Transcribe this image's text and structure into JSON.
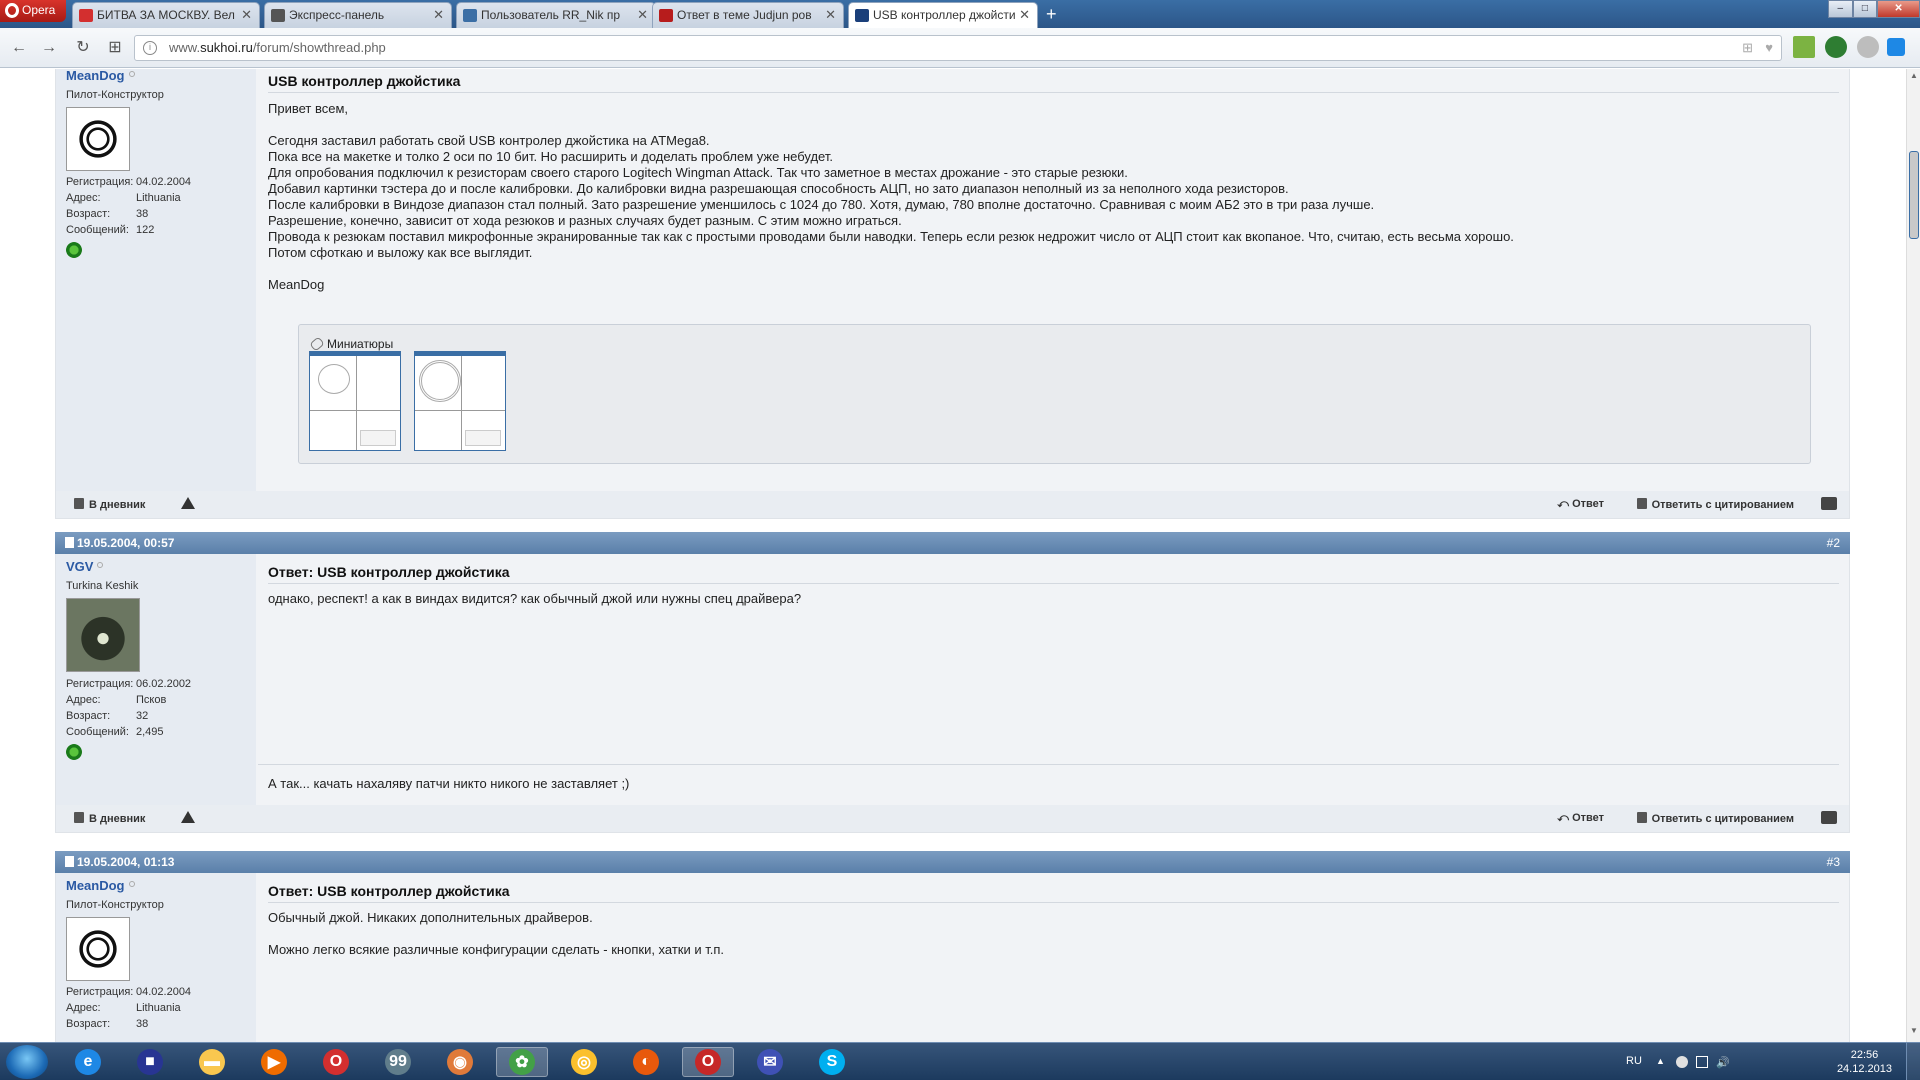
{
  "browser": {
    "menu_label": "Opera",
    "tabs": [
      {
        "title": "БИТВА ЗА МОСКВУ. Вел",
        "fav_color": "#d32f2f"
      },
      {
        "title": "Экспресс-панель",
        "fav_color": "#555555"
      },
      {
        "title": "Пользователь RR_Nik пр",
        "fav_color": "#3b6ea5"
      },
      {
        "title": "Ответ в теме Judjun ров",
        "fav_color": "#b71c1c"
      },
      {
        "title": "USB контроллер джойсти",
        "fav_color": "#1a3f7a"
      }
    ],
    "new_tab": "+",
    "address": {
      "prefix": "www.",
      "domain": "sukhoi.ru",
      "path": "/forum/showthread.php"
    },
    "window_buttons": {
      "minimize": "–",
      "maximize": "□",
      "close": "✕"
    }
  },
  "posts": [
    {
      "username": "MeanDog",
      "usertitle": "Пилот-Конструктор",
      "stats": [
        {
          "k": "Регистрация:",
          "v": "04.02.2004"
        },
        {
          "k": "Адрес:",
          "v": "Lithuania"
        },
        {
          "k": "Возраст:",
          "v": "38"
        },
        {
          "k": "Сообщений:",
          "v": "122"
        }
      ],
      "title": "USB контроллер джойстика",
      "greeting": "Привет всем,",
      "text": "Сегодня заставил работать свой USB контролер джойстика на ATMega8.\nПока все на макетке и толко 2 оси по 10 бит. Но расширить и доделать проблем уже небудет.\nДля опробования подключил к резисторам своего старого Logitech Wingman Attack. Так что заметное в местах дрожание - это старые резюки.\nДобавил картинки тэстера до и после калибровки. До калибровки видна разрешающая способность АЦП, но зато диапазон неполный из за неполного хода резисторов.\nПосле калибровки в Виндозе диапазон стал полный. Зато разрешение уменшилось с 1024 до 780. Хотя, думаю, 780 вполне достаточно. Сравнивая с моим АБ2 это в три раза лучше.\nРазрешение, конечно, зависит от хода резюков и разных случаях будет разным. С этим можно играться.\nПровода к резюкам поставил микрофонные экранированные так как с простыми проводами были наводки. Теперь если резюк недрожит число от АЦП стоит как вкопаное. Что, считаю, есть весьма хорошо.\nПотом сфоткаю и выложу как все выглядит.",
      "signoff": "MeanDog",
      "thumbs_label": "Миниатюры",
      "footer": {
        "blog": "В дневник",
        "reply": "Ответ",
        "quote": "Ответить с цитированием"
      }
    },
    {
      "date": "19.05.2004, 00:57",
      "num": "#2",
      "username": "VGV",
      "usertitle": "Turkina Keshik",
      "stats": [
        {
          "k": "Регистрация:",
          "v": "06.02.2002"
        },
        {
          "k": "Адрес:",
          "v": "Псков"
        },
        {
          "k": "Возраст:",
          "v": "32"
        },
        {
          "k": "Сообщений:",
          "v": "2,495"
        }
      ],
      "title": "Ответ: USB контроллер джойстика",
      "text": "однако, респект! а как в виндах видится? как обычный джой или нужны спец драйвера?",
      "signature": "А так... качать нахаляву патчи никто никого не заставляет ;)",
      "footer": {
        "blog": "В дневник",
        "reply": "Ответ",
        "quote": "Ответить с цитированием"
      }
    },
    {
      "date": "19.05.2004, 01:13",
      "num": "#3",
      "username": "MeanDog",
      "usertitle": "Пилот-Конструктор",
      "stats": [
        {
          "k": "Регистрация:",
          "v": "04.02.2004"
        },
        {
          "k": "Адрес:",
          "v": "Lithuania"
        },
        {
          "k": "Возраст:",
          "v": "38"
        }
      ],
      "title": "Ответ: USB контроллер джойстика",
      "text": "Обычный джой. Никаких дополнительных драйверов.",
      "text2": "Можно легко всякие различные конфигурации сделать - кнопки, хатки и т.п."
    }
  ],
  "taskbar": {
    "apps": [
      {
        "icon": "ie-icon",
        "color": "#1e88e5",
        "glyph": "e"
      },
      {
        "icon": "save-icon",
        "color": "#283593",
        "glyph": "■"
      },
      {
        "icon": "folder-icon",
        "color": "#f9c74f",
        "glyph": "▬"
      },
      {
        "icon": "media-player-icon",
        "color": "#ef6c00",
        "glyph": "▶"
      },
      {
        "icon": "opera-icon",
        "color": "#d32f2f",
        "glyph": "O"
      },
      {
        "icon": "game-icon",
        "color": "#607d8b",
        "glyph": "99"
      },
      {
        "icon": "gimp-icon",
        "color": "#e07a3a",
        "glyph": "◉"
      },
      {
        "icon": "icq-icon",
        "color": "#43a047",
        "glyph": "✿"
      },
      {
        "icon": "chrome-icon",
        "color": "#fbc02d",
        "glyph": "◎"
      },
      {
        "icon": "firefox-icon",
        "color": "#e8590c",
        "glyph": "◐"
      },
      {
        "icon": "opera-active-icon",
        "color": "#c62828",
        "glyph": "O"
      },
      {
        "icon": "thunderbird-icon",
        "color": "#3f51b5",
        "glyph": "✉"
      },
      {
        "icon": "skype-icon",
        "color": "#00aff0",
        "glyph": "S"
      }
    ],
    "lang": "RU",
    "time": "22:56",
    "date": "24.12.2013"
  }
}
